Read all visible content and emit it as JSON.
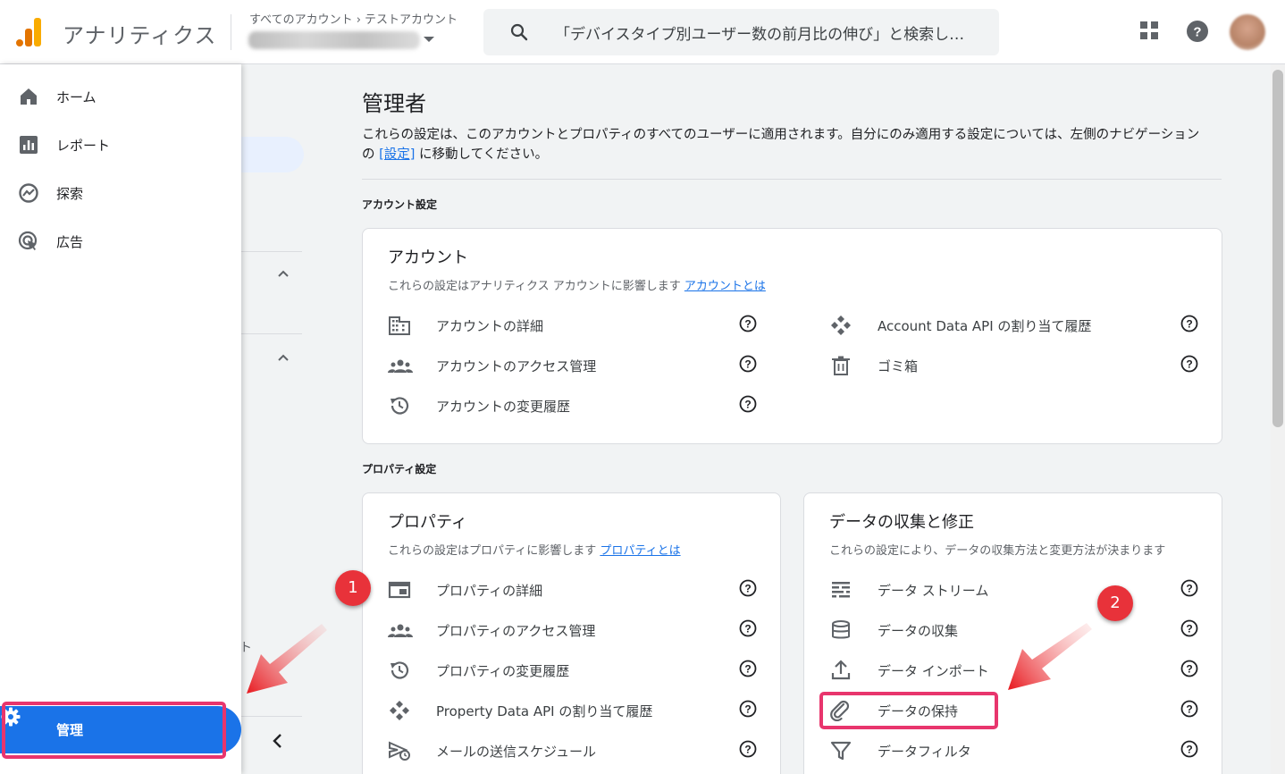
{
  "header": {
    "app_title": "アナリティクス",
    "breadcrumb": "すべてのアカウント › テストアカウント",
    "search_placeholder": "「デバイスタイプ別ユーザー数の前月比の伸び」と検索し…"
  },
  "nav": {
    "home": "ホーム",
    "reports": "レポート",
    "explore": "探索",
    "advertising": "広告",
    "admin": "管理"
  },
  "subpanel": {
    "glyph": "ト"
  },
  "main": {
    "title": "管理者",
    "desc_before": "これらの設定は、このアカウントとプロパティのすべてのユーザーに適用されます。自分にのみ適用する設定については、左側のナビゲーションの ",
    "desc_link": "[設定]",
    "desc_after": " に移動してください。"
  },
  "account_section": {
    "label": "アカウント設定",
    "card": {
      "title": "アカウント",
      "subtitle": "これらの設定はアナリティクス アカウントに影響します ",
      "link": "アカウントとは",
      "left_items": [
        "アカウントの詳細",
        "アカウントのアクセス管理",
        "アカウントの変更履歴"
      ],
      "right_items": [
        "Account Data API の割り当て履歴",
        "ゴミ箱"
      ]
    }
  },
  "property_section": {
    "label": "プロパティ設定",
    "property_card": {
      "title": "プロパティ",
      "subtitle": "これらの設定はプロパティに影響します ",
      "link": "プロパティとは",
      "items": [
        "プロパティの詳細",
        "プロパティのアクセス管理",
        "プロパティの変更履歴",
        "Property Data API の割り当て履歴",
        "メールの送信スケジュール"
      ]
    },
    "data_card": {
      "title": "データの収集と修正",
      "subtitle": "これらの設定により、データの収集方法と変更方法が決まります",
      "items": [
        "データ ストリーム",
        "データの収集",
        "データ インポート",
        "データの保持",
        "データフィルタ"
      ]
    }
  },
  "annotations": {
    "badge1": "1",
    "badge2": "2"
  },
  "colors": {
    "accent": "#1a73e8",
    "highlight": "#e8356d",
    "badge": "#e8323a"
  }
}
